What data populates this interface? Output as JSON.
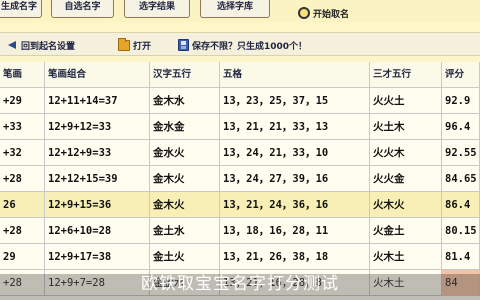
{
  "tabs": [
    {
      "label": "生成名字"
    },
    {
      "label": "自选名字"
    },
    {
      "label": "选字结果"
    },
    {
      "label": "选择字库"
    }
  ],
  "start_button": {
    "label": "开始取名"
  },
  "toolbar": {
    "back_label": "回到起名设置",
    "open_label": "打开",
    "save_label": "保存不限？只生成1000个！"
  },
  "table": {
    "headers": [
      "笔画",
      "笔画组合",
      "汉字五行",
      "五格",
      "三才五行",
      "评分"
    ],
    "rows": [
      [
        "+29",
        "12+11+14=37",
        "金木水",
        "13，23，25，37，15",
        "火火土",
        "92.9"
      ],
      [
        "+33",
        "12+9+12=33",
        "金水金",
        "13，21，21，33，13",
        "火土木",
        "96.4"
      ],
      [
        "+32",
        "12+12+9=33",
        "金水火",
        "13，24，21，33，10",
        "火火木",
        "92.55"
      ],
      [
        "+28",
        "12+12+15=39",
        "金木火",
        "13，24，27，39，16",
        "火火金",
        "84.65"
      ],
      [
        "26",
        "12+9+15=36",
        "金木火",
        "13，21，24，36，16",
        "火木火",
        "86.4"
      ],
      [
        "+28",
        "12+6+10=28",
        "金土水",
        "13，18，16，28，11",
        "火金土",
        "80.15"
      ],
      [
        "29",
        "12+9+17=38",
        "金土火",
        "13，21，26，38，18",
        "火木土",
        "81.4"
      ],
      [
        "+28",
        "12+9+7=28",
        "金金水",
        "13，21，16，28，8",
        "火木土",
        "84"
      ]
    ]
  },
  "caption": "欧铁取宝宝名字打分测试"
}
